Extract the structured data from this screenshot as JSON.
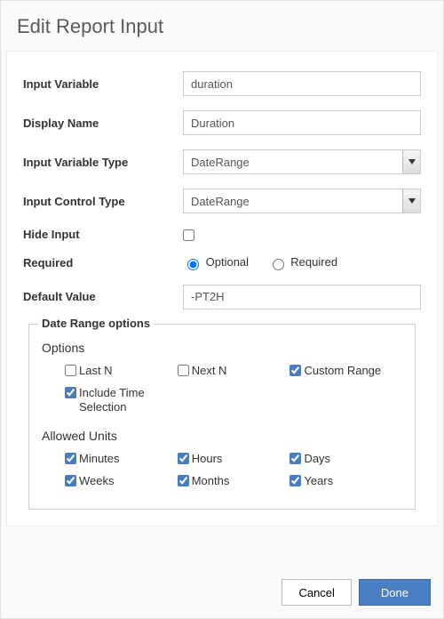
{
  "dialog": {
    "title": "Edit Report Input"
  },
  "fields": {
    "inputVariable": {
      "label": "Input Variable",
      "value": "duration"
    },
    "displayName": {
      "label": "Display Name",
      "value": "Duration"
    },
    "inputVariableType": {
      "label": "Input Variable Type",
      "value": "DateRange"
    },
    "inputControlType": {
      "label": "Input Control Type",
      "value": "DateRange"
    },
    "hideInput": {
      "label": "Hide Input",
      "checked": false
    },
    "required": {
      "label": "Required",
      "options": {
        "optional": "Optional",
        "required": "Required"
      },
      "selected": "optional"
    },
    "defaultValue": {
      "label": "Default Value",
      "value": "-PT2H"
    }
  },
  "dateRange": {
    "legend": "Date Range options",
    "optionsHeader": "Options",
    "unitsHeader": "Allowed Units",
    "options": {
      "lastN": {
        "label": "Last N",
        "checked": false
      },
      "nextN": {
        "label": "Next N",
        "checked": false
      },
      "customRange": {
        "label": "Custom Range",
        "checked": true
      },
      "includeTime": {
        "label": "Include Time Selection",
        "checked": true
      }
    },
    "units": {
      "minutes": {
        "label": "Minutes",
        "checked": true
      },
      "hours": {
        "label": "Hours",
        "checked": true
      },
      "days": {
        "label": "Days",
        "checked": true
      },
      "weeks": {
        "label": "Weeks",
        "checked": true
      },
      "months": {
        "label": "Months",
        "checked": true
      },
      "years": {
        "label": "Years",
        "checked": true
      }
    }
  },
  "buttons": {
    "cancel": "Cancel",
    "done": "Done"
  }
}
